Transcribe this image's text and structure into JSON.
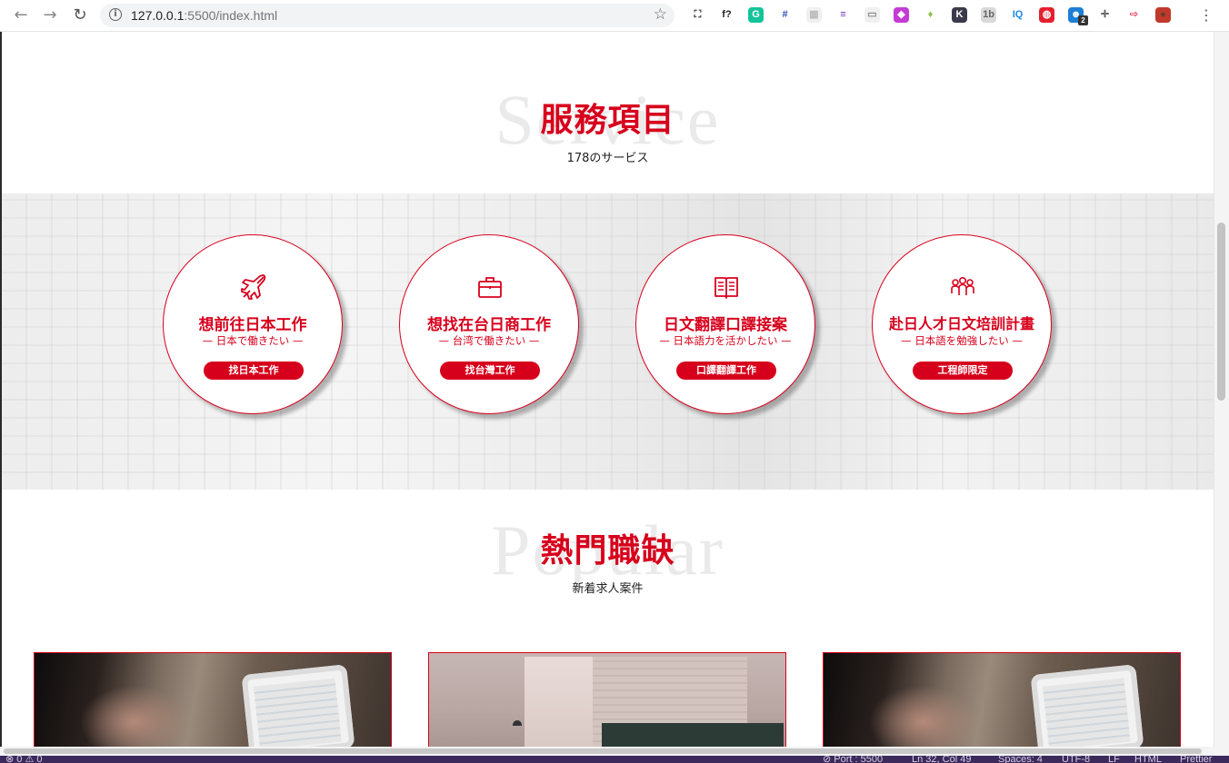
{
  "browser": {
    "url_host": "127.0.0.1",
    "url_rest": ":5500/index.html",
    "extensions": [
      {
        "name": "screenshot-icon",
        "glyph": "⛶",
        "color": "#ffffff",
        "fg": "#333333"
      },
      {
        "name": "font-finder-icon",
        "glyph": "f?",
        "color": "#ffffff",
        "fg": "#222222"
      },
      {
        "name": "grammarly-icon",
        "glyph": "G",
        "color": "#15c39a",
        "fg": "#ffffff"
      },
      {
        "name": "crop-icon",
        "glyph": "#",
        "color": "#ffffff",
        "fg": "#2b4bb3"
      },
      {
        "name": "page-ruler-icon",
        "glyph": "▦",
        "color": "#f0f0f0",
        "fg": "#bbbbbb"
      },
      {
        "name": "stylebot-icon",
        "glyph": "≡",
        "color": "#ffffff",
        "fg": "#6a2bbd"
      },
      {
        "name": "window-resizer-icon",
        "glyph": "▭",
        "color": "#f0f0f0",
        "fg": "#888888"
      },
      {
        "name": "color-picker-icon",
        "glyph": "◆",
        "color": "#c43bd6",
        "fg": "#ffffff"
      },
      {
        "name": "diamond-icon",
        "glyph": "♦",
        "color": "#ffffff",
        "fg": "#8bc34a"
      },
      {
        "name": "k-extension-icon",
        "glyph": "K",
        "color": "#3a3a4a",
        "fg": "#ffffff"
      },
      {
        "name": "1b-extension-icon",
        "glyph": "1b",
        "color": "#d9d9d9",
        "fg": "#666666"
      },
      {
        "name": "iq-extension-icon",
        "glyph": "IQ",
        "color": "#ffffff",
        "fg": "#1e88e5"
      },
      {
        "name": "opera-vpn-icon",
        "glyph": "◍",
        "color": "#e5202e",
        "fg": "#ffffff"
      },
      {
        "name": "ghostery-icon",
        "glyph": "☻",
        "color": "#1e7fd6",
        "fg": "#ffffff"
      },
      {
        "name": "move-icon",
        "glyph": "✛",
        "color": "#ffffff",
        "fg": "#555555"
      },
      {
        "name": "cast-icon",
        "glyph": "⇨",
        "color": "#ffffff",
        "fg": "#e55a6b"
      },
      {
        "name": "profile-avatar-icon",
        "glyph": "●",
        "color": "#c0392b",
        "fg": "#6b3b2a"
      }
    ],
    "ghostery_badge": "2"
  },
  "service": {
    "bg_word": "Service",
    "title": "服務項目",
    "subtitle": "178のサービス",
    "items": [
      {
        "icon": "airplane",
        "title": "想前往日本工作",
        "sub": "— 日本で働きたい —",
        "button": "找日本工作"
      },
      {
        "icon": "briefcase",
        "title": "想找在台日商工作",
        "sub": "— 台湾で働きたい —",
        "button": "找台灣工作"
      },
      {
        "icon": "book",
        "title": "日文翻譯口譯接案",
        "sub": "— 日本語力を活かしたい —",
        "button": "口譯翻譯工作"
      },
      {
        "icon": "people",
        "title": "赴日人才日文培訓計畫",
        "sub": "— 日本語を勉強したい —",
        "button": "工程師限定"
      }
    ]
  },
  "popular": {
    "bg_word": "Popular",
    "title": "熱門職缺",
    "subtitle": "新着求人案件"
  },
  "statusbar": {
    "left": "⊗ 0 ⚠ 0",
    "port": "⊘ Port : 5500",
    "cursor": "Ln 32, Col 49",
    "spaces": "Spaces: 4",
    "encoding": "UTF-8",
    "eol": "LF",
    "lang": "HTML",
    "formatter": "Prettier"
  },
  "colors": {
    "brand_red": "#d7001c"
  }
}
